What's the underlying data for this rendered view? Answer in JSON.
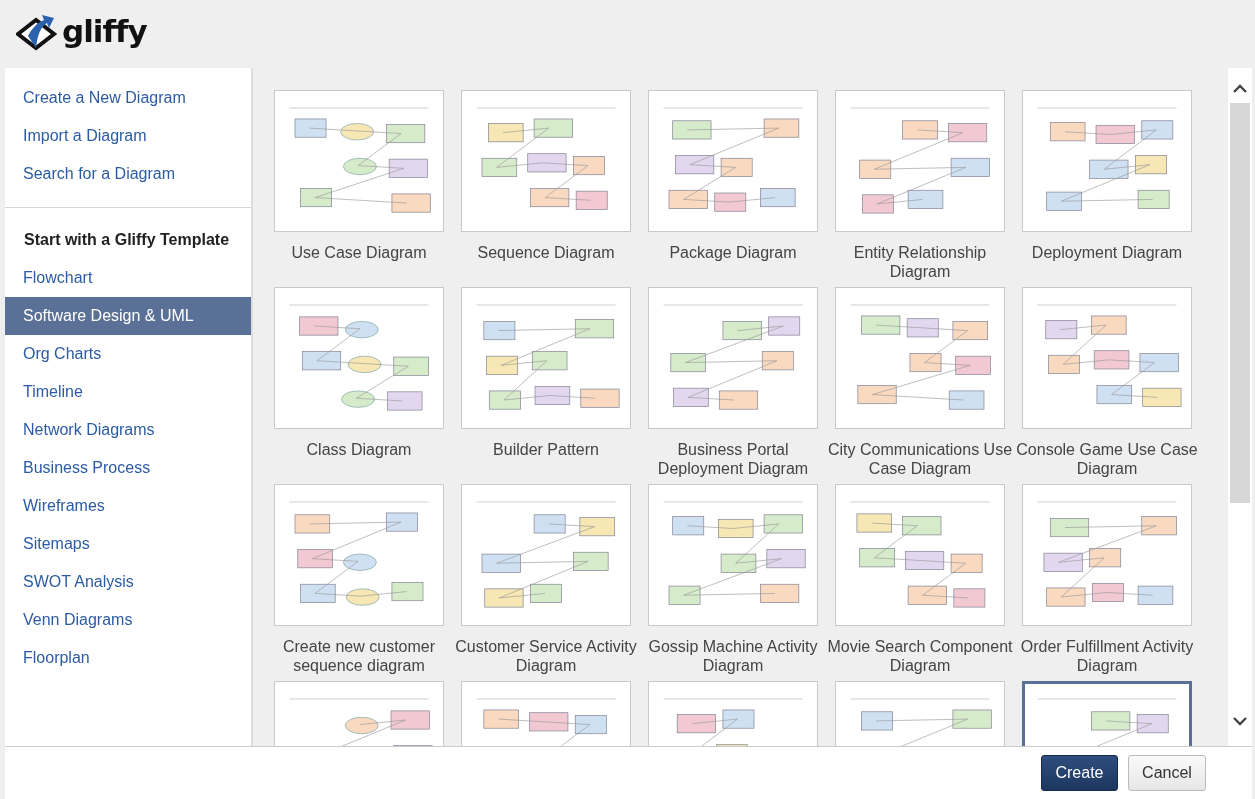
{
  "logo": {
    "text": "gliffy"
  },
  "sidebar": {
    "links": [
      "Create a New Diagram",
      "Import a Diagram",
      "Search for a Diagram"
    ],
    "heading": "Start with a Gliffy Template",
    "items": [
      {
        "label": "Flowchart",
        "selected": false
      },
      {
        "label": "Software Design & UML",
        "selected": true
      },
      {
        "label": "Org Charts",
        "selected": false
      },
      {
        "label": "Timeline",
        "selected": false
      },
      {
        "label": "Network Diagrams",
        "selected": false
      },
      {
        "label": "Business Process",
        "selected": false
      },
      {
        "label": "Wireframes",
        "selected": false
      },
      {
        "label": "Sitemaps",
        "selected": false
      },
      {
        "label": "SWOT Analysis",
        "selected": false
      },
      {
        "label": "Venn Diagrams",
        "selected": false
      },
      {
        "label": "Floorplan",
        "selected": false
      }
    ]
  },
  "templates": [
    {
      "title": "Use Case Diagram",
      "selected": false
    },
    {
      "title": "Sequence Diagram",
      "selected": false
    },
    {
      "title": "Package Diagram",
      "selected": false
    },
    {
      "title": "Entity Relationship Diagram",
      "selected": false
    },
    {
      "title": "Deployment Diagram",
      "selected": false
    },
    {
      "title": "Class Diagram",
      "selected": false
    },
    {
      "title": "Builder Pattern",
      "selected": false
    },
    {
      "title": "Business Portal Deployment Diagram",
      "selected": false
    },
    {
      "title": "City Communications Use Case Diagram",
      "selected": false
    },
    {
      "title": "Console Game Use Case Diagram",
      "selected": false
    },
    {
      "title": "Create new customer sequence diagram",
      "selected": false
    },
    {
      "title": "Customer Service Activity Diagram",
      "selected": false
    },
    {
      "title": "Gossip Machine Activity Diagram",
      "selected": false
    },
    {
      "title": "Movie Search Component Diagram",
      "selected": false
    },
    {
      "title": "Order Fulfillment Activity Diagram",
      "selected": false
    },
    {
      "selected": false
    },
    {
      "selected": false
    },
    {
      "selected": false
    },
    {
      "selected": false
    },
    {
      "selected": true
    }
  ],
  "buttons": [
    {
      "label": "Create",
      "kind": "primary"
    },
    {
      "label": "Cancel",
      "kind": "secondary"
    }
  ]
}
